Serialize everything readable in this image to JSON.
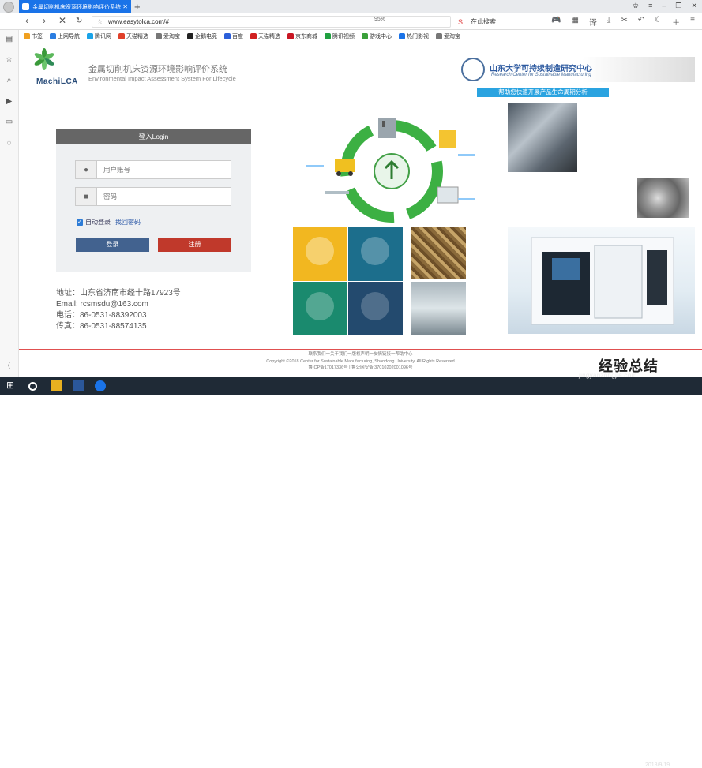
{
  "browser": {
    "tab_title": "金属切削机床资源环境影响评价系统",
    "new_tab": "+",
    "url": "www.easytolca.com/#",
    "zoom": "95%",
    "search_placeholder": "在此搜索",
    "translate": "译"
  },
  "bookmarks": [
    {
      "label": "书签",
      "color": "#f0a020"
    },
    {
      "label": "上网导航",
      "color": "#2a7de1"
    },
    {
      "label": "腾讯网",
      "color": "#1aa3e8"
    },
    {
      "label": "天猫精选",
      "color": "#e0402a"
    },
    {
      "label": "爱淘宝",
      "color": "#777777"
    },
    {
      "label": "企鹅电竞",
      "color": "#222222"
    },
    {
      "label": "百度",
      "color": "#2b5fd9"
    },
    {
      "label": "天猫精选",
      "color": "#d02020"
    },
    {
      "label": "京东商城",
      "color": "#c81623"
    },
    {
      "label": "腾讯视频",
      "color": "#20a040"
    },
    {
      "label": "游戏中心",
      "color": "#3aa03a"
    },
    {
      "label": "热门影视",
      "color": "#1a73e8"
    },
    {
      "label": "爱淘宝",
      "color": "#777777"
    }
  ],
  "header": {
    "logo_text": "MachiLCA",
    "title": "金属切削机床资源环境影响评价系统",
    "subtitle": "Environmental Impact Assessment System For Lifecycle",
    "partner_title": "山东大学可持续制造研究中心",
    "partner_sub": "Research Center for Sustainable Manufacturing",
    "slogan": "帮助您快速开展产品生命周期分析"
  },
  "login": {
    "heading": "登入Login",
    "username_placeholder": "用户账号",
    "password_placeholder": "密码",
    "auto_login": "自动登录",
    "recover": "找回密码",
    "login_button": "登录",
    "register_button": "注册"
  },
  "contact": {
    "address": "地址：山东省济南市经十路17923号",
    "email": "Email: rcsmsdu@163.com",
    "phone": "电话：86-0531-88392003",
    "fax": "传真：86-0531-88574135"
  },
  "footer": {
    "line1": "联系我们一关于我们一版权声明一友情链接一帮助中心",
    "line2": "Copyright ©2018 Center for Sustainable Manufacturing, Shandong University, All Rights Reserved",
    "line3": "鲁ICP备17017336号 | 鲁公网安备 37010202001096号"
  },
  "watermark": {
    "text": "经验总结",
    "sub": "jingyanzongjie.com"
  },
  "taskbar": {
    "date": "2018/9/19"
  },
  "colors": {
    "accent": "#1a73e8",
    "header_line": "#e05050",
    "login_button": "#42628f",
    "register_button": "#c0392b",
    "slogan_bg": "#2aa3e0"
  }
}
